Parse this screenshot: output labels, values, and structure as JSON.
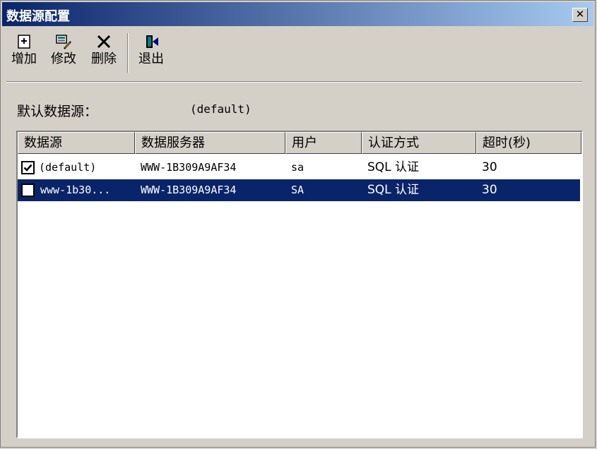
{
  "window": {
    "title": "数据源配置"
  },
  "toolbar": {
    "add_label": "增加",
    "edit_label": "修改",
    "delete_label": "删除",
    "exit_label": "退出"
  },
  "default_source": {
    "label": "默认数据源：",
    "value": "(default)"
  },
  "table": {
    "columns": [
      "数据源",
      "数据服务器",
      "用户",
      "认证方式",
      "超时(秒)"
    ],
    "rows": [
      {
        "checked": true,
        "name": "(default)",
        "server": "WWW-1B309A9AF34",
        "user": "sa",
        "auth": "SQL 认证",
        "timeout": "30"
      },
      {
        "checked": false,
        "name": "www-1b30...",
        "server": "WWW-1B309A9AF34",
        "user": "SA",
        "auth": "SQL 认证",
        "timeout": "30",
        "selected": true
      }
    ]
  },
  "colors": {
    "selection": "#0a246a",
    "face": "#d4d0c8"
  },
  "icons": [
    "add-icon",
    "edit-icon",
    "delete-icon",
    "exit-icon",
    "close-icon",
    "check-icon"
  ]
}
